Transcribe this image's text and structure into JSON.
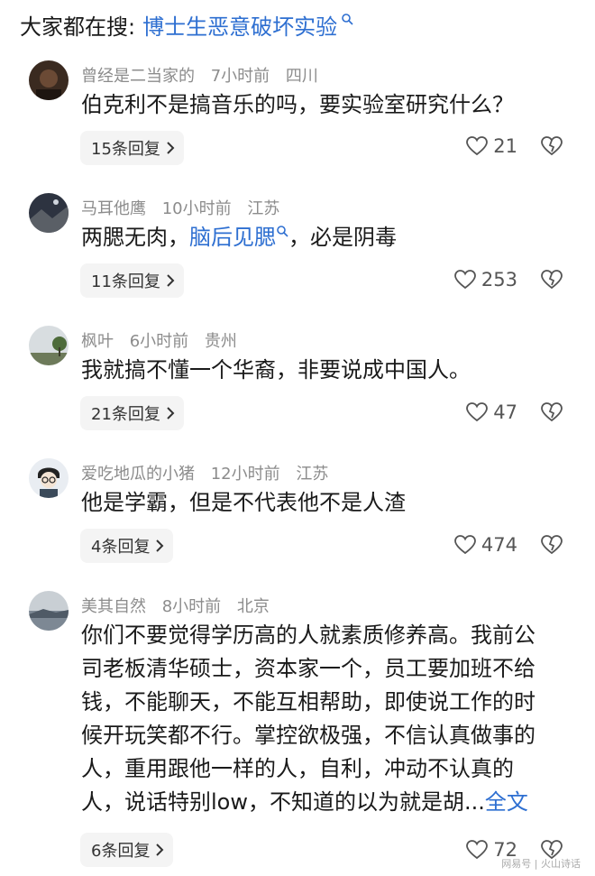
{
  "search": {
    "label": "大家都在搜:",
    "term": "博士生恶意破坏实验"
  },
  "comments": [
    {
      "user": "曾经是二当家的",
      "time": "7小时前",
      "loc": "四川",
      "lines": [
        "伯克利不是搞音乐的吗，要实验室研究什么？"
      ],
      "replies": "15条回复",
      "likes": "21"
    },
    {
      "user": "马耳他鹰",
      "time": "10小时前",
      "loc": "江苏",
      "text_before": "两腮无肉，",
      "link": "脑后见腮",
      "text_after": "，必是阴毒",
      "replies": "11条回复",
      "likes": "253"
    },
    {
      "user": "枫叶",
      "time": "6小时前",
      "loc": "贵州",
      "lines": [
        "我就搞不懂一个华裔，非要说成中国人。"
      ],
      "replies": "21条回复",
      "likes": "47"
    },
    {
      "user": "爱吃地瓜的小猪",
      "time": "12小时前",
      "loc": "江苏",
      "lines": [
        "他是学霸，但是不代表他不是人渣"
      ],
      "replies": "4条回复",
      "likes": "474"
    },
    {
      "user": "美其自然",
      "time": "8小时前",
      "loc": "北京",
      "lines": [
        "你们不要觉得学历高的人就素质修养高。我前公",
        "司老板清华硕士，资本家一个，员工要加班不给",
        "钱，不能聊天，不能互相帮助，即使说工作的时",
        "候开玩笑都不行。掌控欲极强，不信认真做事的",
        "人，重用跟他一样的人，自利，冲动不认真的",
        "人，说话特别low，不知道的以为就是胡..."
      ],
      "full_text": "全文",
      "replies": "6条回复",
      "likes": "72"
    }
  ],
  "watermark": "网易号 | 火山诗话",
  "colors": {
    "link": "#2e6fd1",
    "meta": "#8c8c8c",
    "reply_bg": "#f4f4f4"
  }
}
